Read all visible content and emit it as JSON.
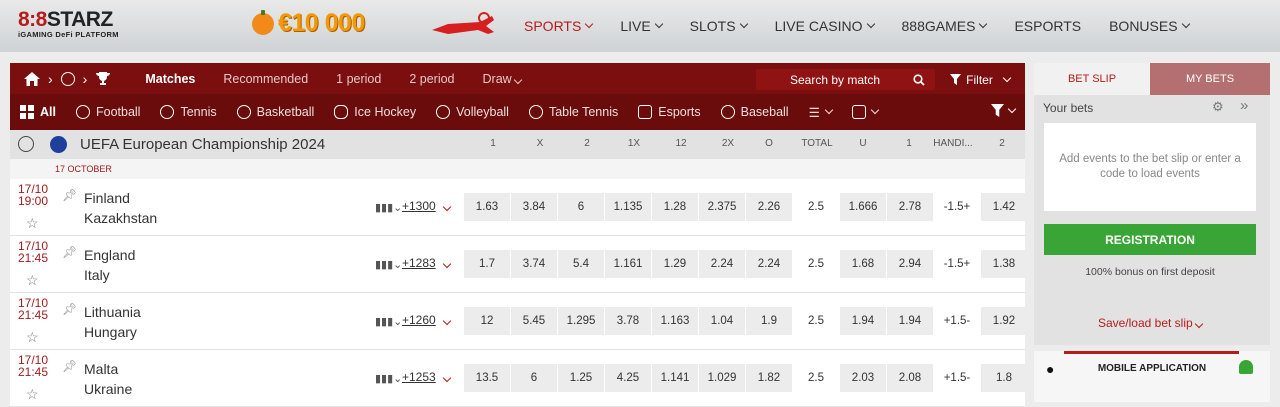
{
  "brand": {
    "logo_left": "8:8",
    "logo_right": "STARZ",
    "tagline": "iGAMING DeFi PLATFORM"
  },
  "promo": {
    "amount": "€10 000"
  },
  "nav": [
    {
      "label": "SPORTS"
    },
    {
      "label": "LIVE"
    },
    {
      "label": "SLOTS"
    },
    {
      "label": "LIVE CASINO"
    },
    {
      "label": "888GAMES"
    },
    {
      "label": "ESPORTS"
    },
    {
      "label": "BONUSES"
    }
  ],
  "filter_bar": {
    "tabs": [
      "Matches",
      "Recommended",
      "1 period",
      "2 period",
      "Draw"
    ],
    "search_label": "Search by match",
    "filter_label": "Filter"
  },
  "sports": [
    "All",
    "Football",
    "Tennis",
    "Basketball",
    "Ice Hockey",
    "Volleyball",
    "Table Tennis",
    "Esports",
    "Baseball"
  ],
  "championship": {
    "title": "UEFA European Championship 2024",
    "columns": [
      "1",
      "X",
      "2",
      "1X",
      "12",
      "2X",
      "O",
      "TOTAL",
      "U",
      "1",
      "HANDI...",
      "2"
    ]
  },
  "date_label": "17 OCTOBER",
  "matches": [
    {
      "date": "17/10",
      "time": "19:00",
      "team1": "Finland",
      "team2": "Kazakhstan",
      "more": "+1300",
      "odds": [
        "1.63",
        "3.84",
        "6",
        "1.135",
        "1.28",
        "2.375",
        "2.26",
        "2.5",
        "1.666",
        "2.78",
        "-1.5+",
        "1.42"
      ]
    },
    {
      "date": "17/10",
      "time": "21:45",
      "team1": "England",
      "team2": "Italy",
      "more": "+1283",
      "odds": [
        "1.7",
        "3.74",
        "5.4",
        "1.161",
        "1.29",
        "2.24",
        "2.24",
        "2.5",
        "1.68",
        "2.94",
        "-1.5+",
        "1.38"
      ]
    },
    {
      "date": "17/10",
      "time": "21:45",
      "team1": "Lithuania",
      "team2": "Hungary",
      "more": "+1260",
      "odds": [
        "12",
        "5.45",
        "1.295",
        "3.78",
        "1.163",
        "1.04",
        "1.9",
        "2.5",
        "1.94",
        "1.94",
        "+1.5-",
        "1.92"
      ]
    },
    {
      "date": "17/10",
      "time": "21:45",
      "team1": "Malta",
      "team2": "Ukraine",
      "more": "+1253",
      "odds": [
        "13.5",
        "6",
        "1.25",
        "4.25",
        "1.141",
        "1.029",
        "1.82",
        "2.5",
        "2.03",
        "2.08",
        "+1.5-",
        "1.8"
      ]
    }
  ],
  "betslip": {
    "tab_slip": "BET SLIP",
    "tab_mybets": "MY BETS",
    "your_bets": "Your bets",
    "empty_text": "Add events to the bet slip or enter a code to load events",
    "register": "REGISTRATION",
    "bonus": "100% bonus on first deposit",
    "save_load": "Save/load bet slip"
  },
  "mobile": {
    "title": "MOBILE APPLICATION"
  }
}
